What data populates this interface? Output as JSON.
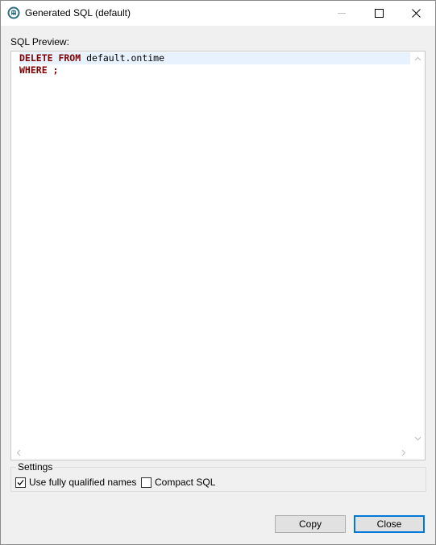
{
  "window": {
    "title": "Generated SQL (default)",
    "icon": "app-icon"
  },
  "preview": {
    "label": "SQL Preview:",
    "lines": [
      {
        "parts": [
          {
            "text": "DELETE FROM",
            "kind": "keyword"
          },
          {
            "text": " default.ontime",
            "kind": "plain"
          }
        ]
      },
      {
        "parts": [
          {
            "text": "WHERE ;",
            "kind": "keyword"
          }
        ]
      }
    ],
    "current_line": 1
  },
  "settings": {
    "label": "Settings",
    "options": [
      {
        "label": "Use fully qualified names",
        "checked": true
      },
      {
        "label": "Compact SQL",
        "checked": false
      }
    ]
  },
  "buttons": {
    "copy": "Copy",
    "close": "Close"
  },
  "colors": {
    "keyword": "#7f0000",
    "current_line": "#e8f2fe",
    "default_button_border": "#0078d7"
  }
}
